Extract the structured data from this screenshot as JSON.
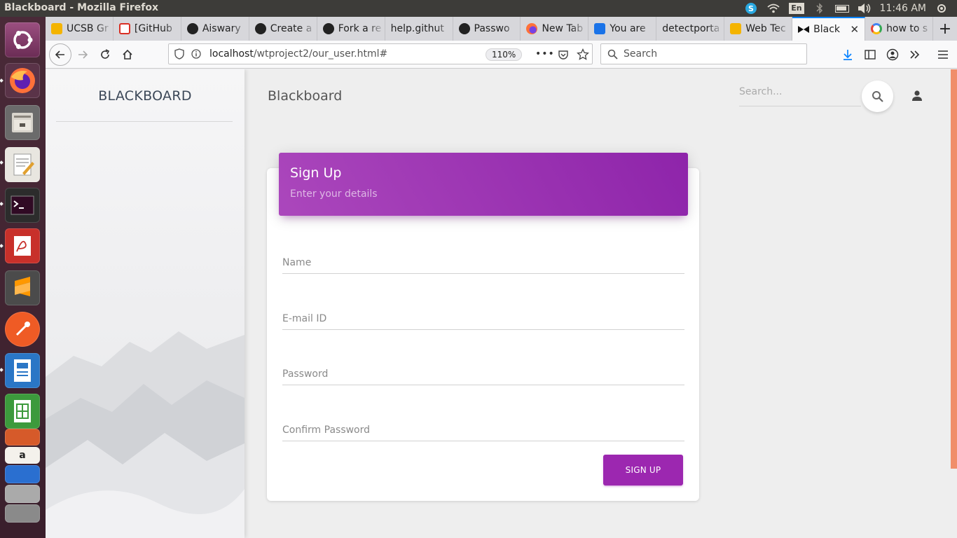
{
  "os": {
    "window_title": "Blackboard - Mozilla Firefox",
    "keyboard_layout": "En",
    "clock": "11:46 AM"
  },
  "launcher": {
    "apps": [
      "ubuntu-dash",
      "firefox",
      "files",
      "text-editor",
      "terminal",
      "pdf-viewer",
      "sublime-text",
      "postman",
      "writer",
      "calc",
      "software-center",
      "amazon",
      "system-monitor",
      "more"
    ]
  },
  "browser": {
    "tabs": [
      {
        "label": "UCSB Gr",
        "icon": "sheets-icon",
        "color": "#f4b400"
      },
      {
        "label": "[GitHub",
        "icon": "gmail-icon",
        "color": "#d93025"
      },
      {
        "label": "Aiswary",
        "icon": "github-icon",
        "color": "#222222"
      },
      {
        "label": "Create a",
        "icon": "github-icon",
        "color": "#222222"
      },
      {
        "label": "Fork a re",
        "icon": "github-icon",
        "color": "#222222"
      },
      {
        "label": "help.githut",
        "icon": "none",
        "color": ""
      },
      {
        "label": "Passwo",
        "icon": "github-icon",
        "color": "#222222"
      },
      {
        "label": "New Tab",
        "icon": "firefox-icon",
        "color": "#e66000"
      },
      {
        "label": "You are",
        "icon": "s-icon",
        "color": "#1a73e8"
      },
      {
        "label": "detectporta",
        "icon": "none",
        "color": ""
      },
      {
        "label": "Web Tec",
        "icon": "slides-icon",
        "color": "#f4b400"
      },
      {
        "label": "Black",
        "icon": "bowtie-icon",
        "color": "#111111",
        "active": true
      },
      {
        "label": "how to s",
        "icon": "google-icon",
        "color": "#4285f4"
      }
    ],
    "url_host": "localhost",
    "url_path": "/wtproject2/our_user.html#",
    "zoom": "110%",
    "search_placeholder": "Search"
  },
  "page": {
    "brand": "BLACKBOARD",
    "title": "Blackboard",
    "search_placeholder": "Search...",
    "card": {
      "title": "Sign Up",
      "subtitle": "Enter your details",
      "fields": [
        "Name",
        "E-mail ID",
        "Password",
        "Confirm Password"
      ],
      "submit_label": "SIGN UP"
    }
  },
  "colors": {
    "accent": "#9c27b0",
    "scroll_thumb": "#f08e6a",
    "tab_highlight": "#0a84ff"
  }
}
